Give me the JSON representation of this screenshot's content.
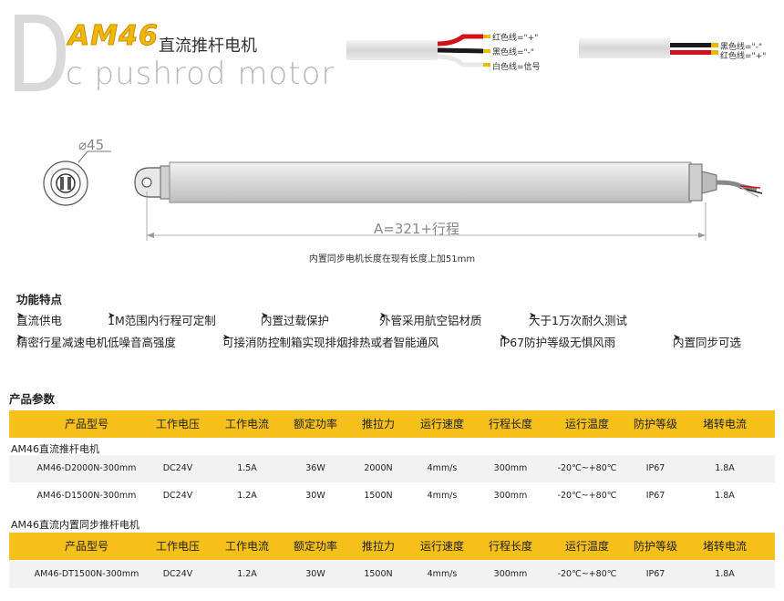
{
  "header": {
    "model": "AM46",
    "title_cn": "直流推杆电机",
    "title_en": "c pushrod motor"
  },
  "wires": {
    "left": [
      "红色线=\"+\"",
      "黑色线=\"-\"",
      "白色线=信号"
    ],
    "right": [
      "黑色线=\"-\"",
      "红色线=\"+\""
    ]
  },
  "drawing": {
    "diameter": "⌀45",
    "stroke": "A=321+行程",
    "note": "内置同步电机长度在现有长度上加51mm"
  },
  "features": {
    "title": "功能特点",
    "row1": [
      "直流供电",
      "1M范围内行程可定制",
      "内置过载保护",
      "外管采用航空铝材质",
      "大于1万次耐久测试"
    ],
    "row2": [
      "精密行星减速电机低噪音高强度",
      "可接消防控制箱实现排烟排热或者智能通风",
      "IP67防护等级无惧风雨",
      "内置同步可选"
    ]
  },
  "params": {
    "title": "产品参数",
    "headers": [
      "产品型号",
      "工作电压",
      "工作电流",
      "额定功率",
      "推拉力",
      "运行速度",
      "行程长度",
      "运行温度",
      "防护等级",
      "堵转电流"
    ],
    "groups": [
      {
        "label": "AM46直流推杆电机",
        "rows": [
          [
            "AM46-D2000N-300mm",
            "DC24V",
            "1.5A",
            "36W",
            "2000N",
            "4mm/s",
            "300mm",
            "-20℃~+80℃",
            "IP67",
            "1.8A"
          ],
          [
            "AM46-D1500N-300mm",
            "DC24V",
            "1.2A",
            "30W",
            "1500N",
            "4mm/s",
            "300mm",
            "-20℃~+80℃",
            "IP67",
            "1.8A"
          ]
        ]
      },
      {
        "label": "AM46直流内置同步推杆电机",
        "rows": [
          [
            "AM46-DT1500N-300mm",
            "DC24V",
            "1.2A",
            "30W",
            "1500N",
            "4mm/s",
            "300mm",
            "-20℃~+80℃",
            "IP67",
            "1.8A"
          ]
        ]
      }
    ]
  }
}
